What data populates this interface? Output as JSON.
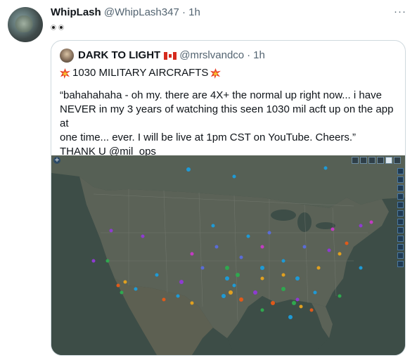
{
  "tweet": {
    "display_name": "WhipLash",
    "handle": "@WhipLash347",
    "separator": "·",
    "time": "1h",
    "more_label": "···",
    "text_emoji": "eyes"
  },
  "quoted_tweet": {
    "display_name": "DARK TO LIGHT",
    "flag": "canada-flag",
    "handle": "@mrslvandco",
    "separator": "·",
    "time": "1h",
    "title": "1030 MILITARY AIRCRAFTS",
    "title_emoji": "collision",
    "body_lines": [
      "“bahahahaha - oh my. there are 4X+ the normal up right now... i have",
      "NEVER in my 3 years of watching this seen 1030 mil acft up on the app at",
      "one time... ever. I will be live at 1pm CST on YouTube. Cheers.”",
      "THANK U @mil_ops"
    ],
    "media": {
      "type": "flight-tracker-map",
      "region": "continental United States",
      "colors": {
        "land": "#555a52",
        "water": "#3d4d47",
        "plane_colors": [
          "#1e9ad6",
          "#8e3bd1",
          "#2fa84f",
          "#e0a020",
          "#e05a1a",
          "#c23bc2",
          "#5a6cd6"
        ]
      }
    }
  }
}
